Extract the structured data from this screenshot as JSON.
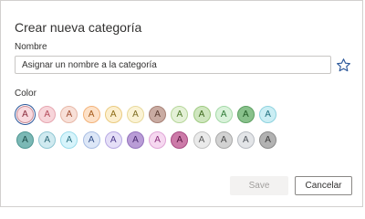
{
  "dialog": {
    "title": "Crear nueva categoría",
    "name_label": "Nombre",
    "name_placeholder": "Asignar un nombre a la categoría",
    "name_value": "",
    "favorite_icon": "star-outline-icon",
    "color_label": "Color",
    "save_label": "Save",
    "cancel_label": "Cancelar"
  },
  "swatch_letter": "A",
  "selected_swatch": 0,
  "swatches": [
    [
      {
        "bg": "#f9dadf",
        "border": "#c98c97",
        "text": "#8a2c3e"
      },
      {
        "bg": "#f7d5da",
        "border": "#e6a7b1",
        "text": "#b3495a"
      },
      {
        "bg": "#f8e0d8",
        "border": "#e7b8a8",
        "text": "#a24f32"
      },
      {
        "bg": "#fde1c8",
        "border": "#f3b37a",
        "text": "#a45a1a"
      },
      {
        "bg": "#fcefcf",
        "border": "#eacb81",
        "text": "#8a6a14"
      },
      {
        "bg": "#fbf3d5",
        "border": "#e8d99c",
        "text": "#7d6d22"
      },
      {
        "bg": "#c9aba2",
        "border": "#a88277",
        "text": "#5a3b31"
      },
      {
        "bg": "#e4f1d7",
        "border": "#b7d79b",
        "text": "#4f7a2a"
      },
      {
        "bg": "#cfe6bf",
        "border": "#9fcb82",
        "text": "#3f6a1f"
      },
      {
        "bg": "#d9f2da",
        "border": "#a5d9a8",
        "text": "#2f7a36"
      },
      {
        "bg": "#88c18b",
        "border": "#5da062",
        "text": "#1f5a24"
      },
      {
        "bg": "#cbeef4",
        "border": "#8fd3df",
        "text": "#1f6f7d"
      }
    ],
    [
      {
        "bg": "#7bb8b5",
        "border": "#4f9793",
        "text": "#1a4b48"
      },
      {
        "bg": "#d0eaf0",
        "border": "#8fc6d2",
        "text": "#2a6776"
      },
      {
        "bg": "#d7f4fb",
        "border": "#9adceb",
        "text": "#2b6f80"
      },
      {
        "bg": "#dde7f7",
        "border": "#a8bde3",
        "text": "#34508a"
      },
      {
        "bg": "#e5dff7",
        "border": "#b7a8e3",
        "text": "#4d3a8c"
      },
      {
        "bg": "#b99cd6",
        "border": "#9473bd",
        "text": "#4a2a70"
      },
      {
        "bg": "#f6d8f0",
        "border": "#e0a5d6",
        "text": "#8a2e7a"
      },
      {
        "bg": "#cc7aa8",
        "border": "#a84b82",
        "text": "#5a1642"
      },
      {
        "bg": "#eaeaea",
        "border": "#c2c2c2",
        "text": "#5a5a5a"
      },
      {
        "bg": "#d2d2d2",
        "border": "#a8a8a8",
        "text": "#4a4a4a"
      },
      {
        "bg": "#e3e5e8",
        "border": "#b8bcc2",
        "text": "#4f545a"
      },
      {
        "bg": "#b2b2b2",
        "border": "#8a8a8a",
        "text": "#3a3a3a"
      }
    ]
  ]
}
